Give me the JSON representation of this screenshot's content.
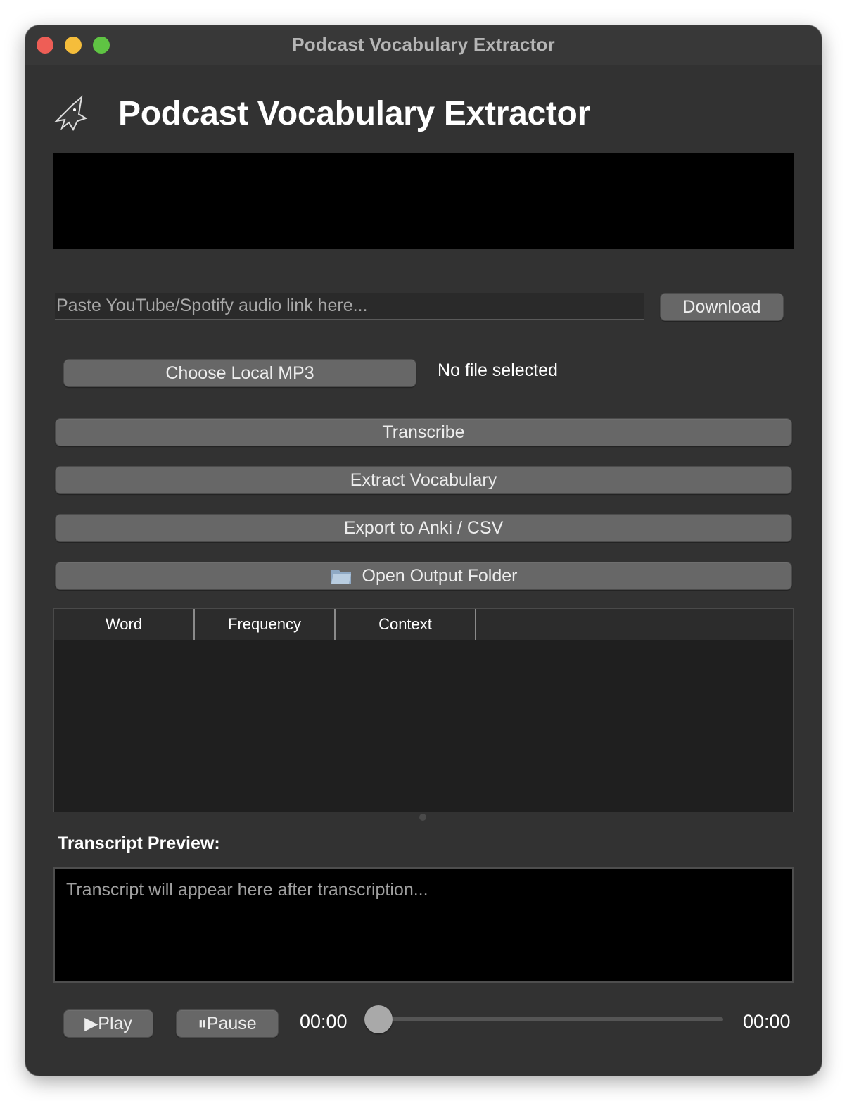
{
  "window": {
    "title": "Podcast Vocabulary Extractor",
    "traffic_lights": [
      "close",
      "minimize",
      "maximize"
    ]
  },
  "header": {
    "title": "Podcast Vocabulary Extractor",
    "logo_icon": "bat-icon"
  },
  "download": {
    "placeholder": "Paste YouTube/Spotify audio link here...",
    "value": "",
    "button_label": "Download"
  },
  "local_file": {
    "button_label": "Choose Local MP3",
    "status": "No file selected"
  },
  "actions": {
    "transcribe": "Transcribe",
    "extract": "Extract Vocabulary",
    "export": "Export to Anki / CSV",
    "open_folder": "Open Output Folder",
    "open_folder_icon": "folder-icon"
  },
  "table": {
    "columns": [
      "Word",
      "Frequency",
      "Context"
    ],
    "rows": []
  },
  "transcript": {
    "label": "Transcript Preview:",
    "placeholder": "Transcript will appear here after transcription..."
  },
  "player": {
    "play_label": "▶Play",
    "pause_label": "⏸Pause",
    "current_time": "00:00",
    "total_time": "00:00",
    "progress": 0
  },
  "colors": {
    "window_bg": "#323232",
    "button_bg": "#676767",
    "panel_black": "#000000"
  }
}
